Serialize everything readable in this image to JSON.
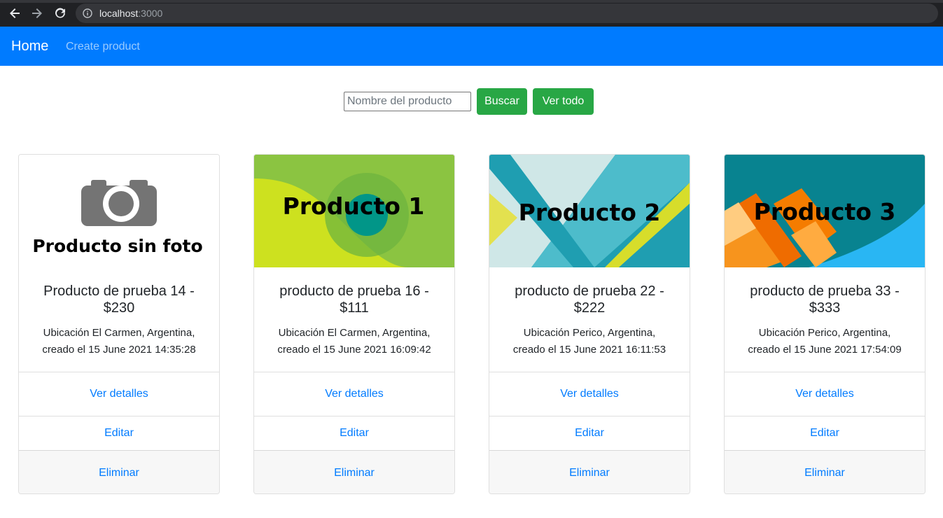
{
  "browser": {
    "url_host": "localhost",
    "url_port": ":3000"
  },
  "navbar": {
    "brand": "Home",
    "links": [
      "Create product"
    ]
  },
  "search": {
    "placeholder": "Nombre del producto",
    "value": "",
    "search_label": "Buscar",
    "view_all_label": "Ver todo"
  },
  "products": [
    {
      "image_text": "Producto sin foto",
      "title_line1": "Producto de prueba 14 -",
      "title_line2": "$230",
      "location": "Ubicación El Carmen, Argentina,",
      "created": "creado el 15 June 2021 14:35:28",
      "details_label": "Ver detalles",
      "edit_label": "Editar",
      "delete_label": "Eliminar"
    },
    {
      "image_text": "Producto 1",
      "title_line1": "producto de prueba 16 -",
      "title_line2": "$111",
      "location": "Ubicación El Carmen, Argentina,",
      "created": "creado el 15 June 2021 16:09:42",
      "details_label": "Ver detalles",
      "edit_label": "Editar",
      "delete_label": "Eliminar"
    },
    {
      "image_text": "Producto 2",
      "title_line1": "producto de prueba 22 -",
      "title_line2": "$222",
      "location": "Ubicación Perico, Argentina,",
      "created": "creado el 15 June 2021 16:11:53",
      "details_label": "Ver detalles",
      "edit_label": "Editar",
      "delete_label": "Eliminar"
    },
    {
      "image_text": "Producto 3",
      "title_line1": "producto de prueba 33 -",
      "title_line2": "$333",
      "location": "Ubicación Perico, Argentina,",
      "created": "creado el 15 June 2021 17:54:09",
      "details_label": "Ver detalles",
      "edit_label": "Editar",
      "delete_label": "Eliminar"
    }
  ],
  "colors": {
    "primary": "#007bff",
    "success": "#28a745",
    "browser_bar": "#202124"
  }
}
